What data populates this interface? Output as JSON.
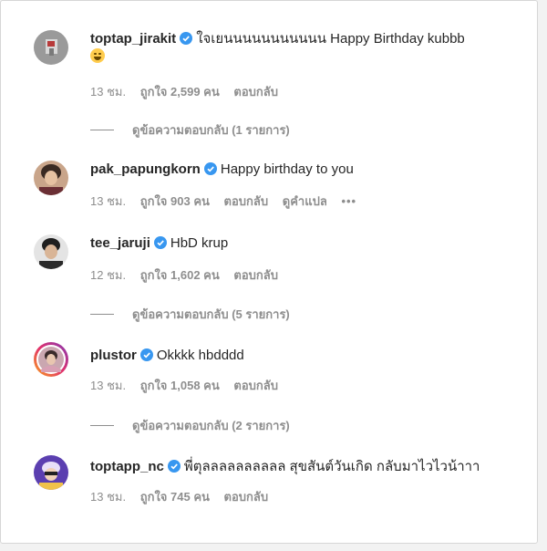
{
  "colors": {
    "verified": "#3897f0",
    "meta_text": "#8e8e8e",
    "username": "#262626"
  },
  "comments": [
    {
      "username": "toptap_jirakit",
      "text": "ใจเยนนนนนนนนนนน Happy Birthday kubbb",
      "emoji": "laughing-emoji",
      "time": "13 ชม.",
      "likes": "ถูกใจ 2,599 คน",
      "reply": "ตอบกลับ",
      "view_replies": "ดูข้อความตอบกลับ (1 รายการ)"
    },
    {
      "username": "pak_papungkorn",
      "text": "Happy birthday to you",
      "time": "13 ชม.",
      "likes": "ถูกใจ 903 คน",
      "reply": "ตอบกลับ",
      "translate": "ดูคำแปล",
      "more": "•••"
    },
    {
      "username": "tee_jaruji",
      "text": "HbD krup",
      "time": "12 ชม.",
      "likes": "ถูกใจ 1,602 คน",
      "reply": "ตอบกลับ",
      "view_replies": "ดูข้อความตอบกลับ (5 รายการ)"
    },
    {
      "username": "plustor",
      "text": "Okkkk hbdddd",
      "time": "13 ชม.",
      "likes": "ถูกใจ 1,058 คน",
      "reply": "ตอบกลับ",
      "view_replies": "ดูข้อความตอบกลับ (2 รายการ)"
    },
    {
      "username": "toptapp_nc",
      "text": "พี่ตุลลลลลลลลลล สุขสันต์วันเกิด กลับมาไวไวน้าาา",
      "time": "13 ชม.",
      "likes": "ถูกใจ 745 คน",
      "reply": "ตอบกลับ"
    }
  ]
}
